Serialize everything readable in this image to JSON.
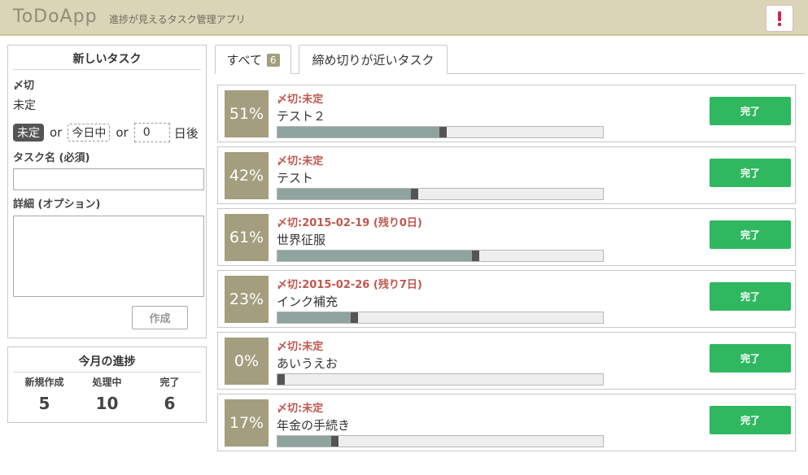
{
  "header": {
    "app_title": "ToDoApp",
    "subtitle": "進捗が見えるタスク管理アプリ",
    "alert_icon": "exclamation-icon",
    "alert_color": "#d6224a"
  },
  "new_task": {
    "title": "新しいタスク",
    "deadline_label": "〆切",
    "deadline_value": "未定",
    "option_undecided": "未定",
    "or_1": "or",
    "option_today": "今日中",
    "or_2": "or",
    "days_value": "0",
    "days_suffix": "日後",
    "task_name_label": "タスク名 (必須)",
    "task_name_value": "",
    "detail_label": "詳細 (オプション)",
    "detail_value": "",
    "create_label": "作成"
  },
  "monthly_progress": {
    "title": "今月の進捗",
    "stats": [
      {
        "label": "新規作成",
        "value": "5"
      },
      {
        "label": "処理中",
        "value": "10"
      },
      {
        "label": "完了",
        "value": "6"
      }
    ]
  },
  "tabs": [
    {
      "label": "すべて",
      "badge": "6",
      "active": true
    },
    {
      "label": "締め切りが近いタスク",
      "active": false
    }
  ],
  "tasks": [
    {
      "percent": "51%",
      "progress": 0.51,
      "due": "〆切:未定",
      "name": "テスト２",
      "done_label": "完了"
    },
    {
      "percent": "42%",
      "progress": 0.42,
      "due": "〆切:未定",
      "name": "テスト",
      "done_label": "完了"
    },
    {
      "percent": "61%",
      "progress": 0.61,
      "due": "〆切:2015-02-19 (残り0日)",
      "name": "世界征服",
      "done_label": "完了"
    },
    {
      "percent": "23%",
      "progress": 0.23,
      "due": "〆切:2015-02-26 (残り7日)",
      "name": "インク補充",
      "done_label": "完了"
    },
    {
      "percent": "0%",
      "progress": 0.0,
      "due": "〆切:未定",
      "name": "あいうえお",
      "done_label": "完了"
    },
    {
      "percent": "17%",
      "progress": 0.17,
      "due": "〆切:未定",
      "name": "年金の手続き",
      "done_label": "完了"
    }
  ],
  "colors": {
    "header_bg": "#d9d5b6",
    "percent_bg": "#a39e7d",
    "done_button": "#2fb85f",
    "due_text": "#c0574f",
    "bar_fill": "#8fa39f"
  }
}
